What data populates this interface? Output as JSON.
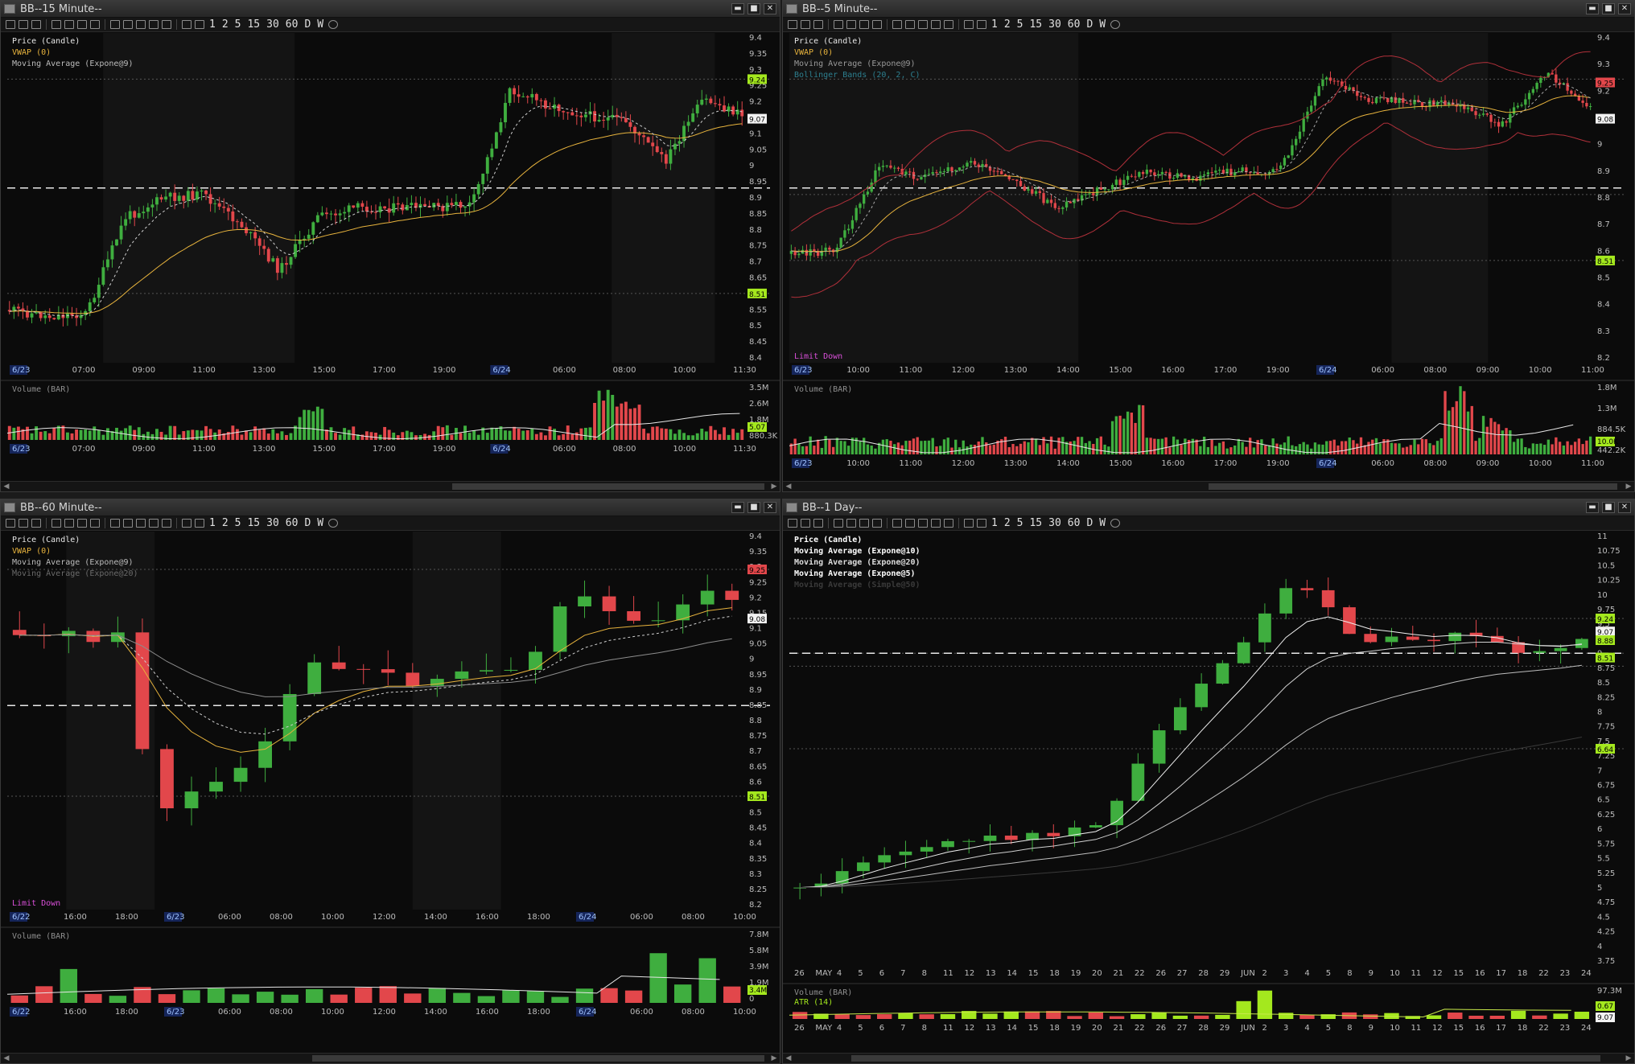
{
  "colors": {
    "up": "#3fae3f",
    "down": "#e2474b",
    "vwap": "#e7b33d",
    "ma": "#d0d0d0",
    "bb": "#b0303a",
    "grid": "#2a2a2a",
    "axis": "#bdbdbd",
    "badge_green": "#a4e81e",
    "badge_red": "#e2474b",
    "date_blue": "#4a8cff"
  },
  "toolbar": {
    "buttons": [
      "1",
      "2",
      "5",
      "15",
      "30",
      "60",
      "D",
      "W"
    ]
  },
  "window_buttons": {
    "minimize": "▬",
    "maximize": "■",
    "close": "✕"
  },
  "panels": [
    {
      "title": "BB--15 Minute--",
      "legend": [
        "Price (Candle)",
        "VWAP (0)",
        "Moving Average (Expone@9)"
      ],
      "legend_colors": [
        "#e8e8e8",
        "#e7b33d",
        "#bcbcbc"
      ],
      "footer_text": "",
      "y_ticks": [
        "9.4",
        "9.35",
        "9.3",
        "9.25",
        "9.2",
        "9.15",
        "9.1",
        "9.05",
        "9",
        "8.95",
        "8.9",
        "8.85",
        "8.8",
        "8.75",
        "8.7",
        "8.65",
        "8.6",
        "8.55",
        "8.5",
        "8.45",
        "8.4"
      ],
      "badges": [
        {
          "label": "9.24",
          "type": "green"
        },
        {
          "label": "9.07",
          "type": "white"
        },
        {
          "label": "8.51",
          "type": "green"
        }
      ],
      "x_labels": [
        "6/23",
        "07:00",
        "09:00",
        "11:00",
        "13:00",
        "15:00",
        "17:00",
        "19:00",
        "6/24",
        "06:00",
        "08:00",
        "10:00",
        "11:30"
      ],
      "volume_label": "Volume (BAR)",
      "volume_ticks": [
        "3.5M",
        "2.6M",
        "1.8M",
        "880.3K"
      ],
      "volume_badge": "5.07"
    },
    {
      "title": "BB--5 Minute--",
      "legend": [
        "Price (Candle)",
        "VWAP (0)",
        "Moving Average (Expone@9)",
        "Bollinger Bands (20, 2, C)"
      ],
      "legend_colors": [
        "#e8e8e8",
        "#e7b33d",
        "#9a9a9a",
        "#2d7f8f"
      ],
      "footer_text": "Limit Down",
      "y_ticks": [
        "9.4",
        "9.3",
        "9.2",
        "9.1",
        "9",
        "8.9",
        "8.8",
        "8.7",
        "8.6",
        "8.5",
        "8.4",
        "8.3",
        "8.2"
      ],
      "badges": [
        {
          "label": "9.25",
          "type": "red"
        },
        {
          "label": "9.08",
          "type": "white"
        },
        {
          "label": "8.51",
          "type": "green"
        }
      ],
      "x_labels": [
        "6/23",
        "10:00",
        "11:00",
        "12:00",
        "13:00",
        "14:00",
        "15:00",
        "16:00",
        "17:00",
        "19:00",
        "6/24",
        "06:00",
        "08:00",
        "09:00",
        "10:00",
        "11:00"
      ],
      "volume_label": "Volume (BAR)",
      "volume_ticks": [
        "1.8M",
        "1.3M",
        "884.5K",
        "442.2K"
      ],
      "volume_badge": "10.0K"
    },
    {
      "title": "BB--60 Minute--",
      "legend": [
        "Price (Candle)",
        "VWAP (0)",
        "Moving Average (Expone@9)",
        "Moving Average (Expone@20)"
      ],
      "legend_colors": [
        "#e8e8e8",
        "#e7b33d",
        "#bcbcbc",
        "#6b6b6b"
      ],
      "footer_text": "Limit Down",
      "y_ticks": [
        "9.4",
        "9.35",
        "9.3",
        "9.25",
        "9.2",
        "9.15",
        "9.1",
        "9.05",
        "9",
        "8.95",
        "8.9",
        "8.85",
        "8.8",
        "8.75",
        "8.7",
        "8.65",
        "8.6",
        "8.55",
        "8.5",
        "8.45",
        "8.4",
        "8.35",
        "8.3",
        "8.25",
        "8.2"
      ],
      "badges": [
        {
          "label": "9.25",
          "type": "red"
        },
        {
          "label": "9.08",
          "type": "white"
        },
        {
          "label": "8.51",
          "type": "green"
        }
      ],
      "x_labels": [
        "6/22",
        "16:00",
        "18:00",
        "6/23",
        "06:00",
        "08:00",
        "10:00",
        "12:00",
        "14:00",
        "16:00",
        "18:00",
        "6/24",
        "06:00",
        "08:00",
        "10:00"
      ],
      "volume_label": "Volume (BAR)",
      "volume_ticks": [
        "7.8M",
        "5.8M",
        "3.9M",
        "1.9M",
        "0"
      ],
      "volume_badge": "3.4M"
    },
    {
      "title": "BB--1 Day--",
      "legend": [
        "Price (Candle)",
        "Moving Average (Expone@10)",
        "Moving Average (Expone@20)",
        "Moving Average (Expone@5)",
        "Moving Average (Simple@50)"
      ],
      "legend_colors": [
        "#ffffff",
        "#ffffff",
        "#dcdcdc",
        "#ffffff",
        "#3a3a3a"
      ],
      "footer_text": "",
      "y_ticks": [
        "11",
        "10.75",
        "10.5",
        "10.25",
        "10",
        "9.75",
        "9.5",
        "9.25",
        "9",
        "8.75",
        "8.5",
        "8.25",
        "8",
        "7.75",
        "7.5",
        "7.25",
        "7",
        "6.75",
        "6.5",
        "6.25",
        "6",
        "5.75",
        "5.5",
        "5.25",
        "5",
        "4.75",
        "4.5",
        "4.25",
        "4",
        "3.75"
      ],
      "badges": [
        {
          "label": "9.24",
          "type": "green"
        },
        {
          "label": "9.07",
          "type": "white"
        },
        {
          "label": "8.88",
          "type": "green"
        },
        {
          "label": "8.51",
          "type": "green"
        },
        {
          "label": "6.64",
          "type": "green"
        }
      ],
      "x_labels": [
        "26",
        "MAY",
        "4",
        "5",
        "6",
        "7",
        "8",
        "11",
        "12",
        "13",
        "14",
        "15",
        "18",
        "19",
        "20",
        "21",
        "22",
        "26",
        "27",
        "28",
        "29",
        "JUN",
        "2",
        "3",
        "4",
        "5",
        "8",
        "9",
        "10",
        "11",
        "12",
        "15",
        "16",
        "17",
        "18",
        "22",
        "23",
        "24"
      ],
      "volume_label": "Volume (BAR)",
      "volume_sub": "ATR (14)",
      "volume_ticks": [
        "97.3M"
      ],
      "volume_badge": "0.67",
      "volume_badge2": "9.07"
    }
  ]
}
